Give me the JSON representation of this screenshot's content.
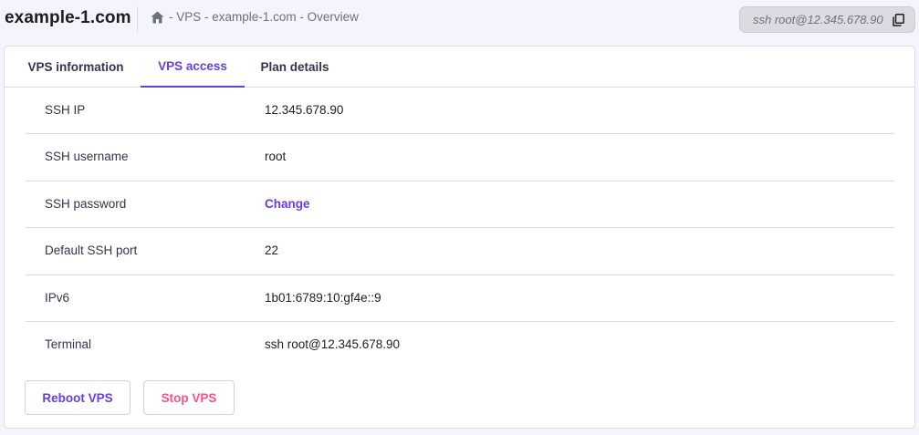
{
  "header": {
    "title": "example-1.com",
    "breadcrumb": [
      "- VPS -",
      "example-1.com",
      "- Overview"
    ],
    "ssh_command": "ssh root@12.345.678.90"
  },
  "tabs": [
    {
      "label": "VPS information",
      "active": false
    },
    {
      "label": "VPS access",
      "active": true
    },
    {
      "label": "Plan details",
      "active": false
    }
  ],
  "access_rows": [
    {
      "label": "SSH IP",
      "value": "12.345.678.90"
    },
    {
      "label": "SSH username",
      "value": "root"
    },
    {
      "label": "SSH password",
      "value": "Change"
    },
    {
      "label": "Default SSH port",
      "value": "22"
    },
    {
      "label": "IPv6",
      "value": "1b01:6789:10:gf4e::9"
    },
    {
      "label": "Terminal",
      "value": "ssh root@12.345.678.90"
    }
  ],
  "buttons": {
    "reboot": "Reboot VPS",
    "stop": "Stop VPS"
  },
  "colors": {
    "accent": "#673de6",
    "danger": "#fc5185",
    "background": "#f4f4fc"
  },
  "icons": {
    "breadcrumb_home": "home-icon",
    "ssh_copy": "copy-icon"
  }
}
